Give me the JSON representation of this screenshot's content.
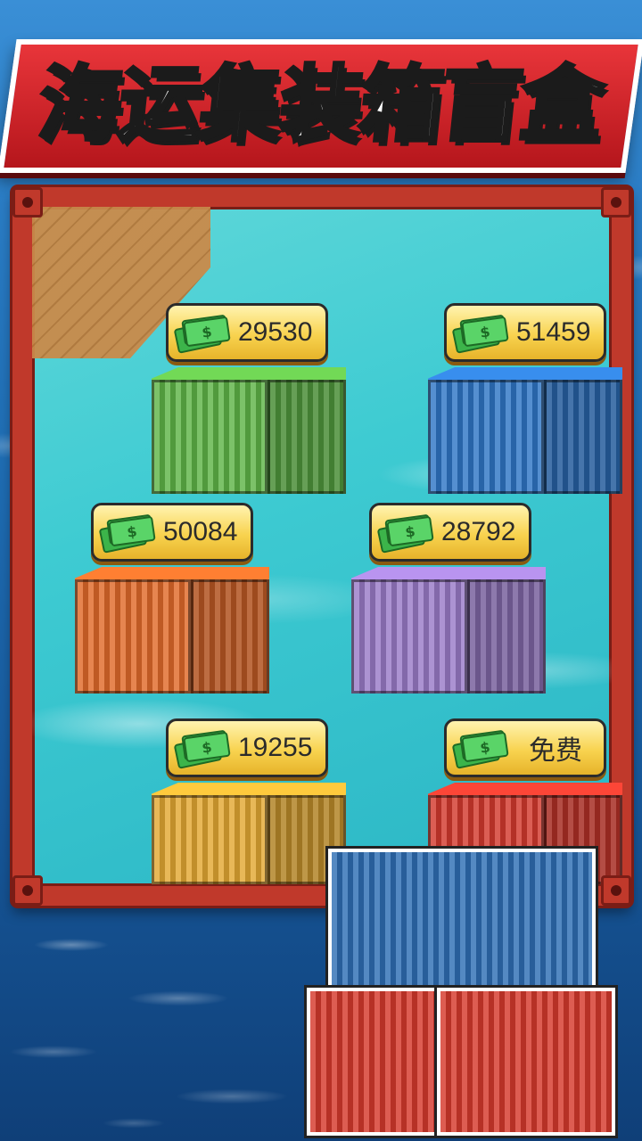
{
  "title": "海运集装箱盲盒",
  "currency_icon_symbol": "$",
  "containers": [
    {
      "id": "green",
      "price": "29530",
      "color": "#5fb548"
    },
    {
      "id": "blue",
      "price": "51459",
      "color": "#2f76c6"
    },
    {
      "id": "orange",
      "price": "50084",
      "color": "#e06a2a"
    },
    {
      "id": "purple",
      "price": "28792",
      "color": "#9a7bc8"
    },
    {
      "id": "yellow",
      "price": "19255",
      "color": "#e3a833"
    },
    {
      "id": "red",
      "price": "免费",
      "color": "#d33a2e"
    }
  ],
  "colors": {
    "frame": "#c0392b",
    "badge": "#f8d34f",
    "water": "#3ecbd2"
  }
}
